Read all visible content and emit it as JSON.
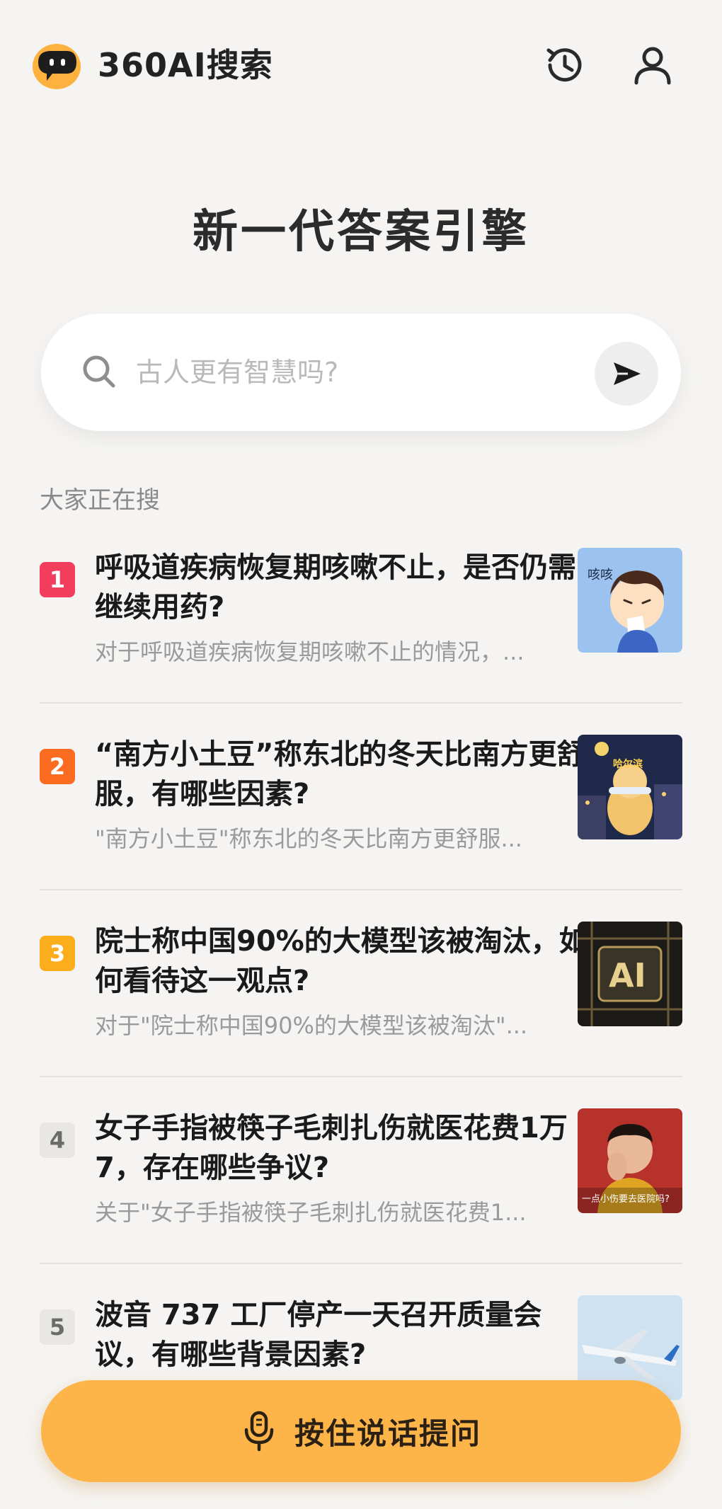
{
  "header": {
    "brand": "360AI搜索",
    "icons": {
      "logo": "chat-bubble-logo-icon",
      "history": "history-clock-icon",
      "user": "user-profile-icon"
    }
  },
  "hero": {
    "title": "新一代答案引擎"
  },
  "search": {
    "placeholder": "古人更有智慧吗?",
    "send_icon": "send-arrow-icon",
    "search_icon": "search-icon"
  },
  "trending": {
    "label": "大家正在搜",
    "items": [
      {
        "rank": "1",
        "rank_color": "#f23e5c",
        "title": "呼吸道疾病恢复期咳嗽不止，是否仍需继续用药?",
        "snippet": "对于呼吸道疾病恢复期咳嗽不止的情况，...",
        "thumb_text": "咳咳"
      },
      {
        "rank": "2",
        "rank_color": "#fb6b22",
        "title": "“南方小土豆”称东北的冬天比南方更舒服，有哪些因素?",
        "snippet": "\"南方小土豆\"称东北的冬天比南方更舒服...",
        "thumb_text": "哈尔滨"
      },
      {
        "rank": "3",
        "rank_color": "#fbad1c",
        "title": "院士称中国90%的大模型该被淘汰，如何看待这一观点?",
        "snippet": "对于\"院士称中国90%的大模型该被淘汰\"...",
        "thumb_text": "AI"
      },
      {
        "rank": "4",
        "rank_color": "#e8e7e4",
        "title": "女子手指被筷子毛刺扎伤就医花费1万7，存在哪些争议?",
        "snippet": "关于\"女子手指被筷子毛刺扎伤就医花费1...",
        "thumb_text": "一点小伤要去医院吗?"
      },
      {
        "rank": "5",
        "rank_color": "#e8e7e4",
        "title": "波音 737 工厂停产一天召开质量会议，有哪些背景因素?",
        "snippet": "",
        "thumb_text": ""
      }
    ]
  },
  "voice": {
    "label": "按住说话提问",
    "icon": "microphone-icon",
    "color": "#fdb54a"
  }
}
